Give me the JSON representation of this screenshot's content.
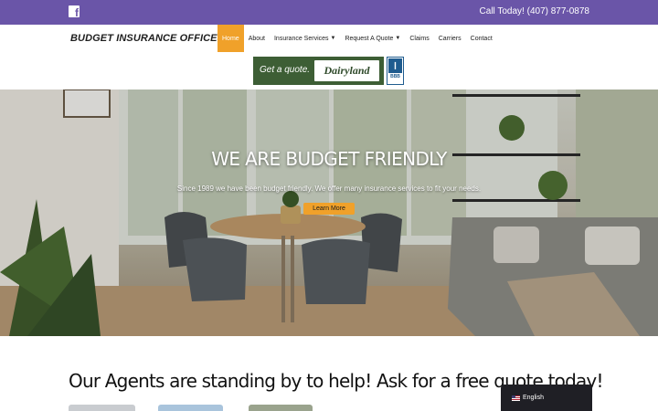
{
  "topbar": {
    "facebook_icon": "facebook-icon",
    "phone": "Call Today! (407) 877-0878",
    "color": "#6a55a8"
  },
  "header": {
    "logo": "BUDGET INSURANCE OFFICES",
    "nav": [
      {
        "label": "Home",
        "active": true
      },
      {
        "label": "About"
      },
      {
        "label": "Insurance Services",
        "dropdown": true
      },
      {
        "label": "Request A Quote",
        "dropdown": true
      },
      {
        "label": "Claims"
      },
      {
        "label": "Carriers"
      },
      {
        "label": "Contact"
      }
    ],
    "accent": "#f0a12a"
  },
  "banner": {
    "get_quote": "Get a quote.",
    "brand": "Dairyland",
    "bbb": "BBB"
  },
  "hero": {
    "title": "WE ARE BUDGET FRIENDLY",
    "subtitle": "Since 1989 we have been budget friendly. We offer many insurance services to fit your needs.",
    "button": "Learn More"
  },
  "section": {
    "title": "Our Agents are standing by to help! Ask for a free quote today!"
  },
  "language": {
    "label": "English",
    "flag_icon": "us-flag-icon"
  }
}
